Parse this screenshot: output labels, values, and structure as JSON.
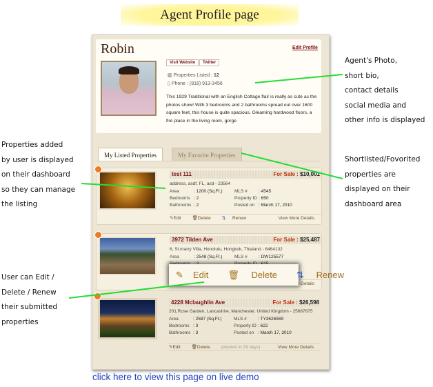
{
  "banner": {
    "title": "Agent Profile page"
  },
  "profile": {
    "name": "Robin",
    "edit_profile": "Edit Profile",
    "visit_website": "Visit Website",
    "twitter": "Twitter",
    "properties_listed_label": "Properties Listed : ",
    "properties_listed": "12",
    "phone": "Phone : (818) 913-3456",
    "bio": "This 1929 Traditional with an English Cottage flair is really as cute as the photos show! With 3 bedrooms and 2 bathrooms spread out over 1600 square feet, this house is quite spacious. Gleaming hardwood floors, a fire place in the living room, gorge"
  },
  "tabs": [
    {
      "label": "My Listed Properties",
      "active": true
    },
    {
      "label": "My Favorite Properties",
      "active": false
    }
  ],
  "labels": {
    "area": "Area",
    "bedrooms": "Bedrooms",
    "bathrooms": "Bathrooms",
    "mls": "MLS #",
    "property_id": "Property ID",
    "posted_on": "Posted on",
    "for_sale": "For Sale : ",
    "edit": "Edit",
    "delete": "Delete",
    "renew": "Renew",
    "view_more": "View More Details"
  },
  "listings": [
    {
      "title": "test 111",
      "price": "$10,001",
      "address": "address, asdf, FL, asd - 23564",
      "area": ": 1200 (Sq.Ft.)",
      "bedrooms": ": 2",
      "bathrooms": ": 2",
      "mls": ": 4545",
      "property_id": ": 650",
      "posted_on": ": March 17, 2010"
    },
    {
      "title": "3972 Tilden Ave",
      "price": "$25,487",
      "address": "6, St.marry Villa, Honolulu, Hongkok, Thialand - 6464132",
      "area": ": 2548 (Sq.Ft.)",
      "bedrooms": ": 3",
      "bathrooms": ": 3",
      "mls": ": DW125577",
      "property_id": ": 615",
      "posted_on": ""
    },
    {
      "title": "4228 Mclaughlin Ave",
      "price": "$26,598",
      "address": "201,Rose Garden, Lancashire, Manchester, United Kingdom - 25687875",
      "area": ": 2587 (Sq.Ft.)",
      "bedrooms": ": 3",
      "bathrooms": ": 3",
      "mls": ": TY3626569",
      "property_id": ": 622",
      "posted_on": ": March 17, 2010",
      "expires": "(expires in 29 days)"
    }
  ],
  "annotations": {
    "profile": [
      "Agent's Photo,",
      "short bio,",
      "contact details",
      "social media and",
      "other info is displayed"
    ],
    "added": [
      "Properties added",
      "by user is displayed",
      "on their dashboard",
      "so they can manage",
      "the listing"
    ],
    "favorites": [
      "Shortlisted/Fovorited",
      "properties are",
      "displayed on their",
      "dashboard area"
    ],
    "edit": [
      "User can Edit /",
      "Delete / Renew",
      "their submitted",
      "properties"
    ]
  },
  "demo_link": "click here to view  this page on live demo",
  "colors": {
    "annotation_line": "#22dd33",
    "link": "#2244bb",
    "accent": "#7a1010"
  }
}
